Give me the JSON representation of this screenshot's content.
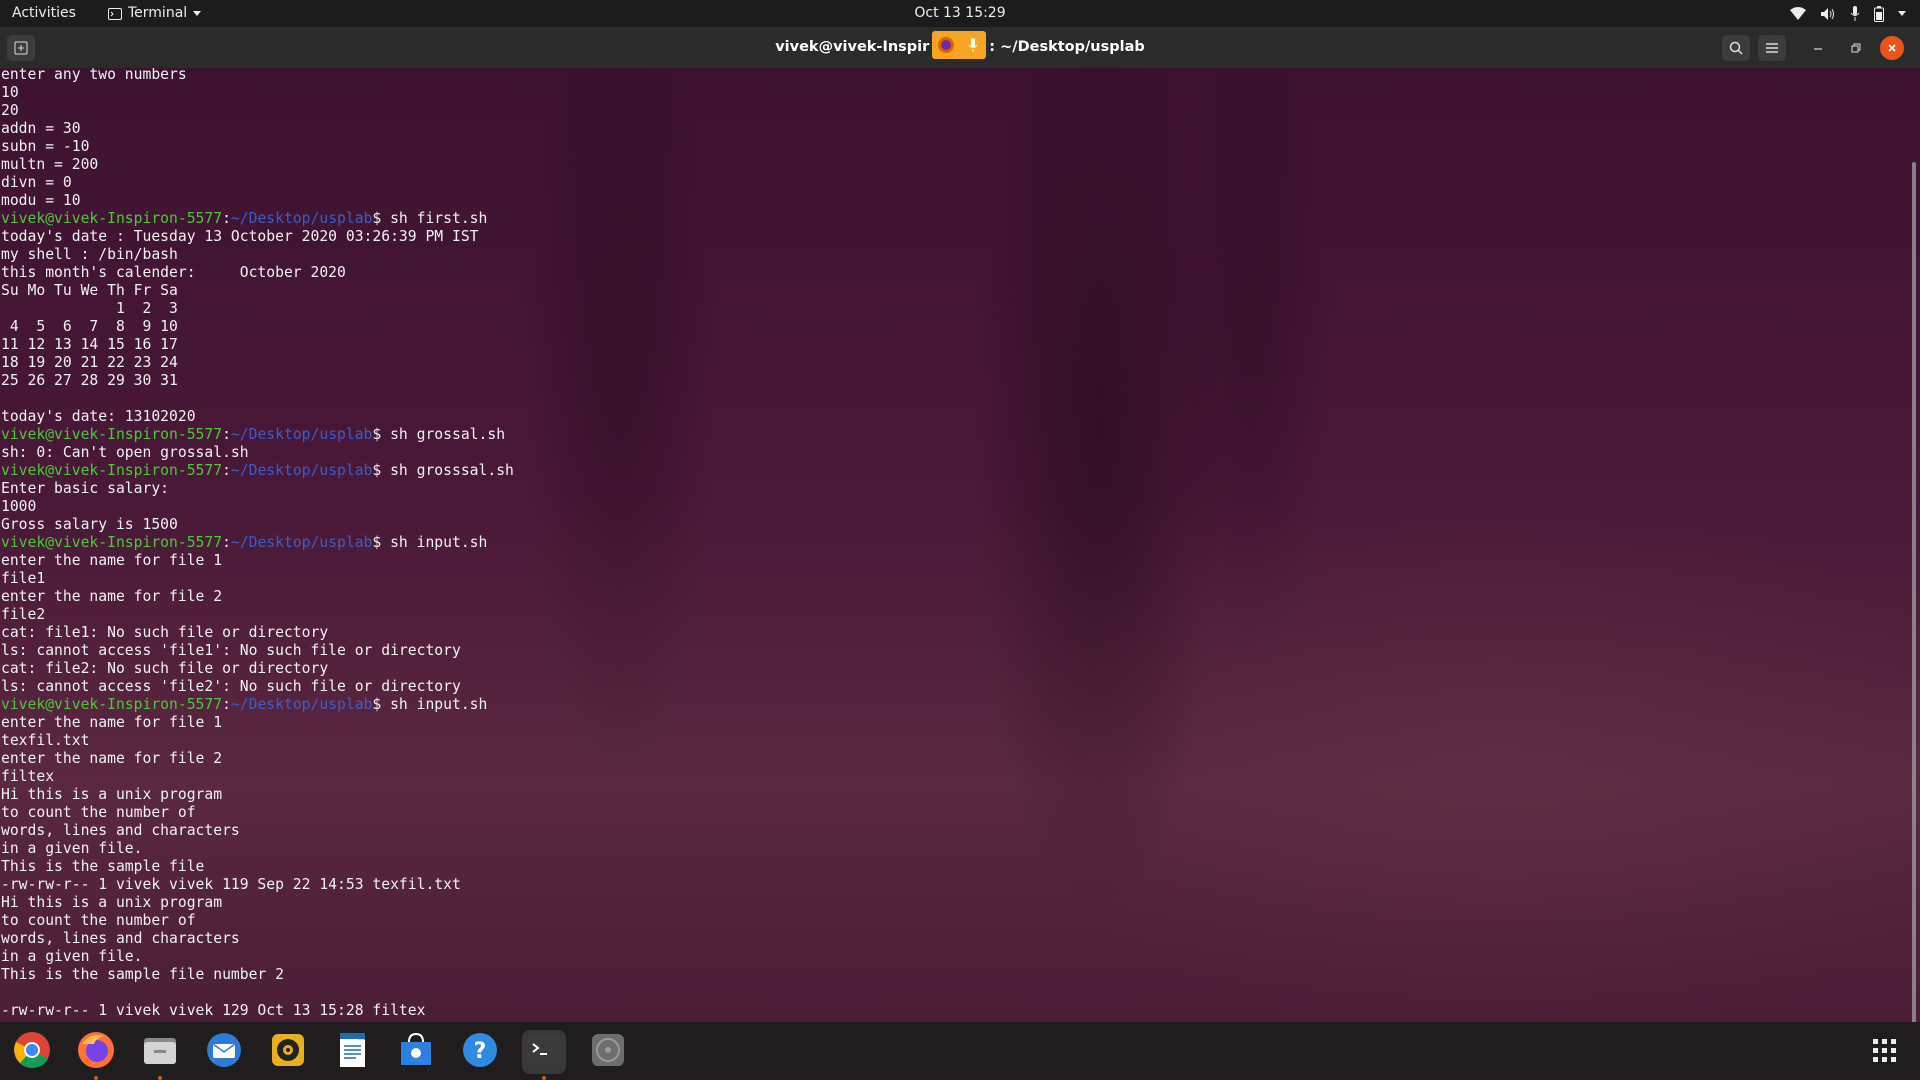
{
  "topbar": {
    "activities": "Activities",
    "app_name": "Terminal",
    "clock": "Oct 13  15:29",
    "status_icons": [
      "wifi-icon",
      "volume-icon",
      "microphone-icon",
      "battery-icon",
      "system-menu-icon"
    ]
  },
  "window": {
    "title_left": "vivek@vivek-Inspir",
    "title_right": ": ~/Desktop/usplab",
    "accent": "#e95420"
  },
  "terminal": {
    "prompt_user": "vivek@vivek-Inspiron-5577",
    "prompt_sep": ":",
    "prompt_path": "~/Desktop/usplab",
    "lines": [
      {
        "text": "enter any two numbers"
      },
      {
        "text": "10"
      },
      {
        "text": "20"
      },
      {
        "text": "addn = 30"
      },
      {
        "text": "subn = -10"
      },
      {
        "text": "multn = 200"
      },
      {
        "text": "divn = 0"
      },
      {
        "text": "modu = 10"
      },
      {
        "cmd": "$ sh first.sh"
      },
      {
        "text": "today's date : Tuesday 13 October 2020 03:26:39 PM IST"
      },
      {
        "text": "my shell : /bin/bash"
      },
      {
        "text": "this month's calender:     October 2020"
      },
      {
        "text": "Su Mo Tu We Th Fr Sa"
      },
      {
        "text": "             1  2  3"
      },
      {
        "text": " 4  5  6  7  8  9 10"
      },
      {
        "text": "11 12 13 14 15 16 17"
      },
      {
        "text": "18 19 20 21 22 23 24"
      },
      {
        "text": "25 26 27 28 29 30 31"
      },
      {
        "text": ""
      },
      {
        "text": "today's date: 13102020"
      },
      {
        "cmd": "$ sh grossal.sh"
      },
      {
        "text": "sh: 0: Can't open grossal.sh"
      },
      {
        "cmd": "$ sh grosssal.sh"
      },
      {
        "text": "Enter basic salary:"
      },
      {
        "text": "1000"
      },
      {
        "text": "Gross salary is 1500"
      },
      {
        "cmd": "$ sh input.sh"
      },
      {
        "text": "enter the name for file 1"
      },
      {
        "text": "file1"
      },
      {
        "text": "enter the name for file 2"
      },
      {
        "text": "file2"
      },
      {
        "text": "cat: file1: No such file or directory"
      },
      {
        "text": "ls: cannot access 'file1': No such file or directory"
      },
      {
        "text": "cat: file2: No such file or directory"
      },
      {
        "text": "ls: cannot access 'file2': No such file or directory"
      },
      {
        "cmd": "$ sh input.sh"
      },
      {
        "text": "enter the name for file 1"
      },
      {
        "text": "texfil.txt"
      },
      {
        "text": "enter the name for file 2"
      },
      {
        "text": "filtex"
      },
      {
        "text": "Hi this is a unix program"
      },
      {
        "text": "to count the number of"
      },
      {
        "text": "words, lines and characters"
      },
      {
        "text": "in a given file."
      },
      {
        "text": "This is the sample file"
      },
      {
        "text": "-rw-rw-r-- 1 vivek vivek 119 Sep 22 14:53 texfil.txt"
      },
      {
        "text": "Hi this is a unix program"
      },
      {
        "text": "to count the number of"
      },
      {
        "text": "words, lines and characters"
      },
      {
        "text": "in a given file."
      },
      {
        "text": "This is the sample file number 2"
      },
      {
        "text": ""
      },
      {
        "text": "-rw-rw-r-- 1 vivek vivek 129 Oct 13 15:28 filtex"
      }
    ]
  },
  "dock": {
    "apps": [
      {
        "name": "chrome-icon",
        "running": false
      },
      {
        "name": "firefox-icon",
        "running": true
      },
      {
        "name": "files-icon",
        "running": true
      },
      {
        "name": "thunderbird-icon",
        "running": false
      },
      {
        "name": "rhythmbox-icon",
        "running": false
      },
      {
        "name": "writer-icon",
        "running": false
      },
      {
        "name": "software-center-icon",
        "running": false
      },
      {
        "name": "help-icon",
        "running": false
      },
      {
        "name": "terminal-icon",
        "running": true
      },
      {
        "name": "disc-icon",
        "running": false
      }
    ]
  }
}
